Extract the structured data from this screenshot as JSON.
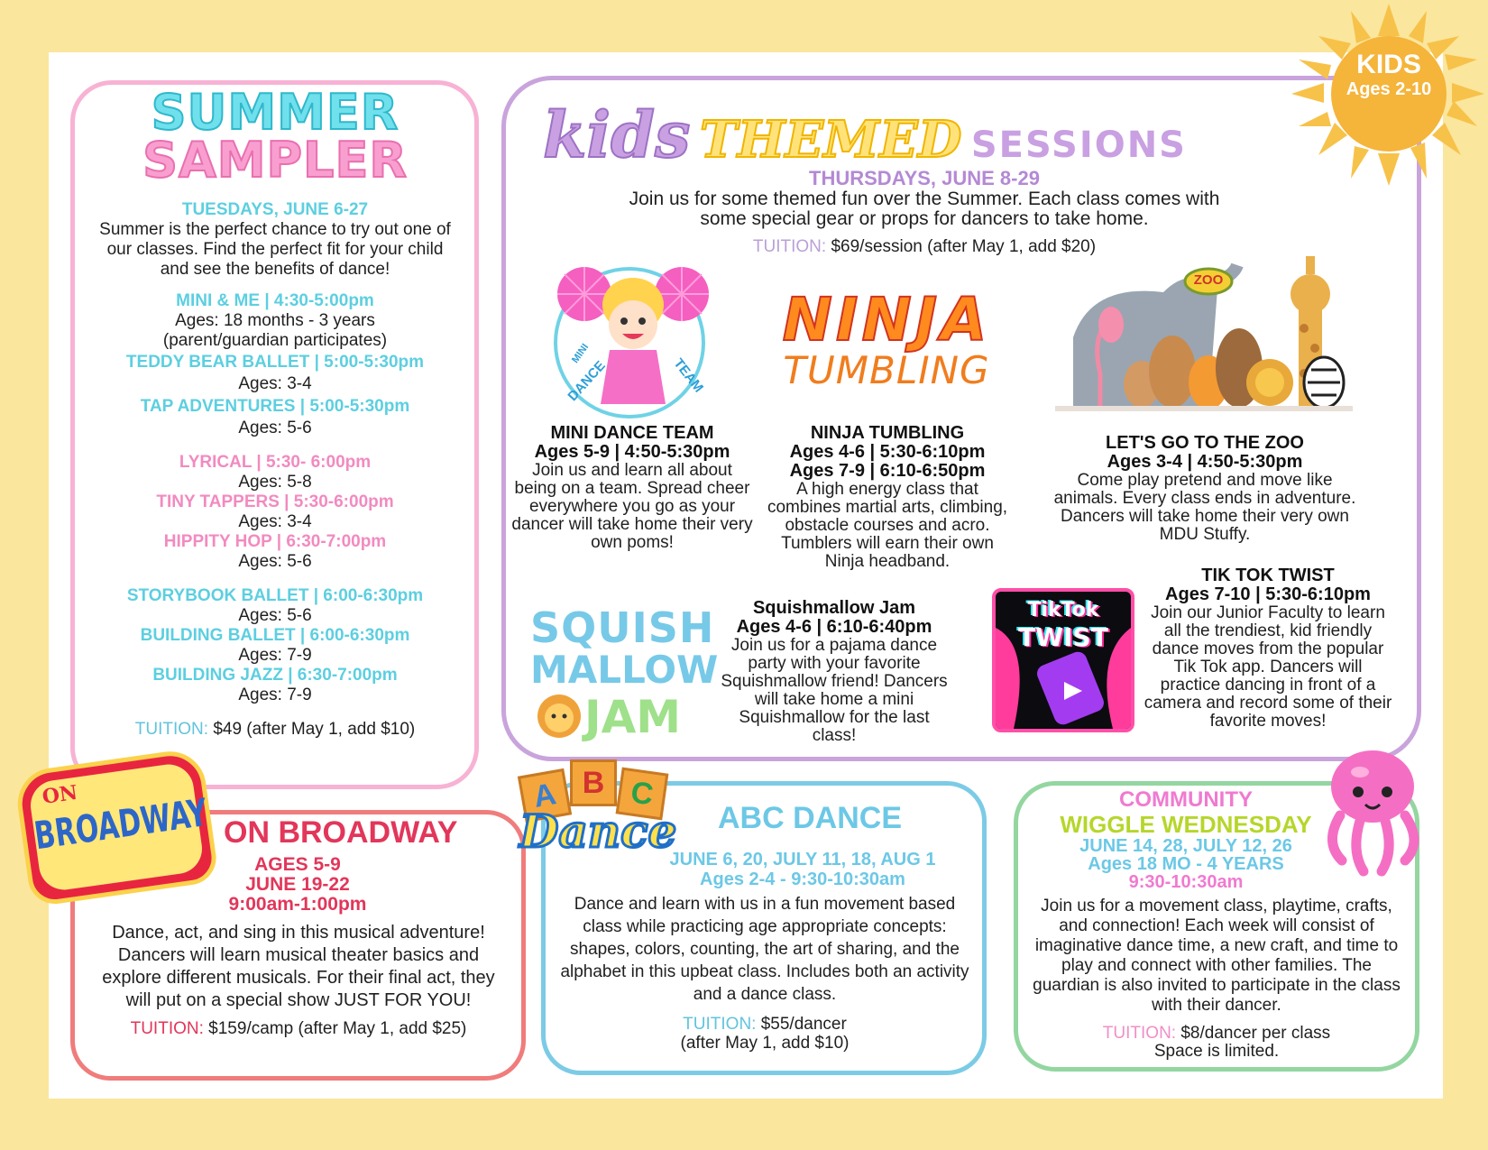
{
  "sampler": {
    "title1": "SUMMER",
    "title2": "SAMPLER",
    "date": "TUESDAYS, JUNE 6-27",
    "intro": "Summer is the perfect chance to try out one of our classes. Find the perfect fit for your child and see the benefits of dance!",
    "classes": [
      {
        "name": "MINI & ME | 4:30-5:00pm",
        "ages": "Ages: 18 months - 3 years",
        "note": "(parent/guardian participates)"
      },
      {
        "name": "TEDDY BEAR BALLET | 5:00-5:30pm",
        "ages": "Ages: 3-4"
      },
      {
        "name": "TAP ADVENTURES | 5:00-5:30pm",
        "ages": "Ages: 5-6"
      },
      {
        "name": "LYRICAL | 5:30- 6:00pm",
        "ages": "Ages: 5-8"
      },
      {
        "name": "TINY TAPPERS | 5:30-6:00pm",
        "ages": "Ages: 3-4"
      },
      {
        "name": "HIPPITY HOP | 6:30-7:00pm",
        "ages": "Ages: 5-6"
      },
      {
        "name": "STORYBOOK BALLET | 6:00-6:30pm",
        "ages": "Ages: 5-6"
      },
      {
        "name": "BUILDING BALLET | 6:00-6:30pm",
        "ages": "Ages: 7-9"
      },
      {
        "name": "BUILDING JAZZ | 6:30-7:00pm",
        "ages": "Ages: 7-9"
      }
    ],
    "tuition_label": "TUITION:",
    "tuition_value": "$49 (after May 1, add $10)"
  },
  "themed": {
    "title_kids": "kids",
    "title_themed": "THEMED",
    "title_sessions": "SESSIONS",
    "date": "THURSDAYS, JUNE 8-29",
    "intro1": "Join us for some themed fun over the Summer. Each class comes with",
    "intro2": "some special gear or props for dancers to take home.",
    "tuition_label": "TUITION:",
    "tuition_value": "$69/session (after May 1, add $20)",
    "mini": {
      "badge1": "MINI",
      "badge2": "DANCE",
      "badge3": "TEAM",
      "title": "MINI DANCE TEAM",
      "time": "Ages 5-9 | 4:50-5:30pm",
      "desc": "Join us and learn all about being on a team. Spread cheer everywhere you go as your dancer will take home their very own poms!"
    },
    "ninja": {
      "logo1": "NINJA",
      "logo2": "TUMBLING",
      "title": "NINJA TUMBLING",
      "time1": "Ages 4-6 | 5:30-6:10pm",
      "time2": "Ages 7-9 | 6:10-6:50pm",
      "desc": "A high energy class that combines martial arts, climbing, obstacle courses and acro. Tumblers will earn their own Ninja headband."
    },
    "zoo": {
      "sign": "ZOO",
      "title": "LET'S GO TO THE ZOO",
      "time": "Ages 3-4 | 4:50-5:30pm",
      "desc": "Come play pretend and move like animals. Every class ends in adventure. Dancers will take home their very own MDU Stuffy."
    },
    "squish": {
      "logo1": "SQUISH",
      "logo2": "MALLOW",
      "logo3": "JAM",
      "title": "Squishmallow Jam",
      "time": "Ages 4-6 | 6:10-6:40pm",
      "desc": "Join us for a pajama dance party with your favorite Squishmallow friend! Dancers will take home a mini Squishmallow for the last class!"
    },
    "tiktok": {
      "logo1": "TikTok",
      "logo2": "TWIST",
      "title": "TIK TOK TWIST",
      "time": "Ages 7-10 | 5:30-6:10pm",
      "desc": "Join our Junior Faculty to learn all the trendiest, kid friendly dance moves from the popular Tik Tok app. Dancers will practice dancing in front of a camera and record some of their favorite moves!"
    }
  },
  "sun": {
    "line1": "KIDS",
    "line2": "Ages 2-10"
  },
  "broadway": {
    "marquee1": "ON",
    "marquee2": "BROADWAY",
    "title": "ON BROADWAY",
    "line1": "AGES 5-9",
    "line2": "JUNE 19-22",
    "line3": "9:00am-1:00pm",
    "desc": "Dance, act, and sing in this musical adventure! Dancers will learn musical theater basics and explore different musicals. For their final act, they will put on a special show JUST FOR YOU!",
    "tuition_label": "TUITION:",
    "tuition_value": "$159/camp (after May 1, add $25)"
  },
  "abc": {
    "blocks": [
      "A",
      "B",
      "C"
    ],
    "logo": "Dance",
    "title": "ABC DANCE",
    "dates": "JUNE 6, 20, JULY 11, 18, AUG 1",
    "time": "Ages 2-4 - 9:30-10:30am",
    "desc": "Dance and learn with us in a fun movement based class while practicing age appropriate concepts: shapes, colors, counting, the art of sharing, and the alphabet in this upbeat class. Includes both an activity and a dance class.",
    "tuition_label": "TUITION:",
    "tuition_value": "$55/dancer",
    "tuition_note": "(after May 1, add $10)"
  },
  "wiggle": {
    "title1": "COMMUNITY",
    "title2": "WIGGLE WEDNESDAY",
    "dates": "JUNE 14, 28, JULY 12, 26",
    "ages": "Ages 18 MO - 4 YEARS",
    "time": "9:30-10:30am",
    "desc": "Join us for a movement class, playtime, crafts, and connection! Each week will consist of imaginative dance time, a new craft, and time to play and connect with other families. The guardian is also invited to participate in the class with their dancer.",
    "tuition_label": "TUITION:",
    "tuition_value": "$8/dancer per class",
    "tuition_note": "Space is limited."
  }
}
